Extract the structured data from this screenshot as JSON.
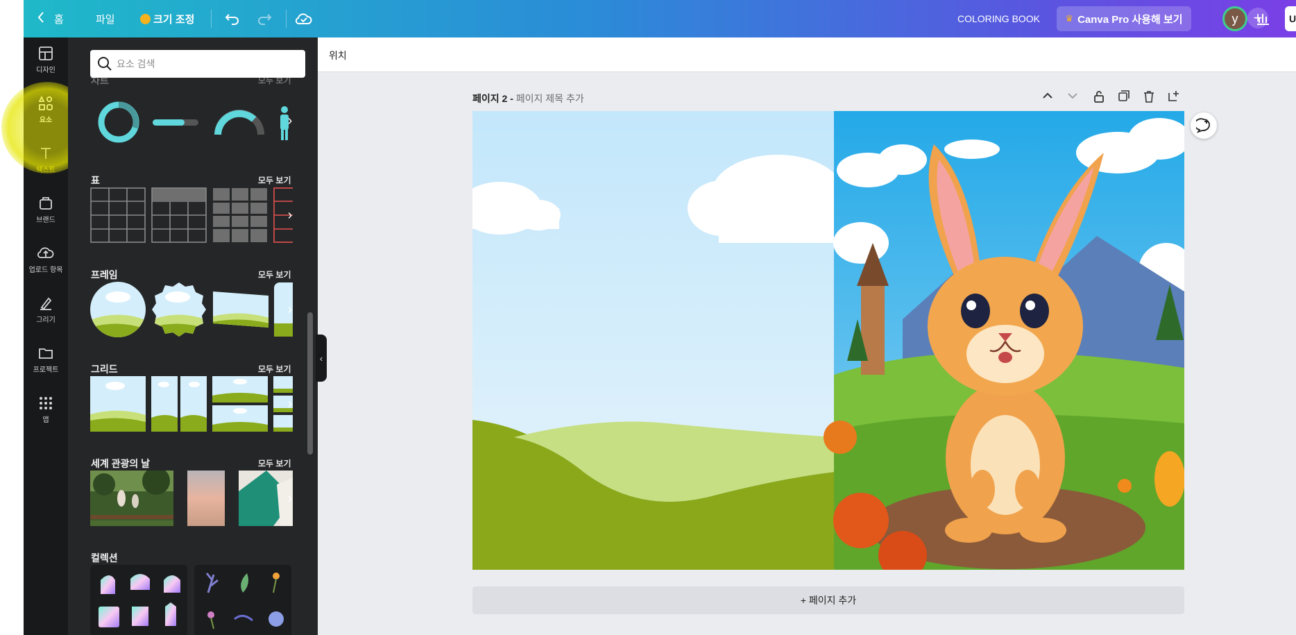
{
  "topbar": {
    "home_label": "홈",
    "file_label": "파일",
    "resize_label": "크기 조정",
    "doc_title": "COLORING BOOK",
    "pro_button": "Canva Pro 사용해 보기",
    "avatar_initial": "y",
    "share_label": "U",
    "gradient_colors": [
      "#1fb9c9",
      "#7a3fe6"
    ]
  },
  "rail": {
    "items": [
      {
        "label": "디자인",
        "icon": "layout-icon"
      },
      {
        "label": "요소",
        "icon": "elements-icon"
      },
      {
        "label": "텍스트",
        "icon": "text-icon"
      },
      {
        "label": "브랜드",
        "icon": "brand-icon"
      },
      {
        "label": "업로드 항목",
        "icon": "upload-icon"
      },
      {
        "label": "그리기",
        "icon": "draw-icon"
      },
      {
        "label": "프로젝트",
        "icon": "folder-icon"
      },
      {
        "label": "앱",
        "icon": "apps-grid-icon"
      }
    ]
  },
  "panel": {
    "search_placeholder": "요소 검색",
    "see_all": "모두 보기",
    "sections": {
      "charts": "차트",
      "tables": "표",
      "frames": "프레임",
      "grids": "그리드",
      "tourism": "세계 관광의 날",
      "collections": "컬렉션"
    }
  },
  "canvas": {
    "position_label": "위치",
    "page_label": "페이지 2 -",
    "page_title_placeholder": "페이지 제목 추가",
    "add_page": "+ 페이지 추가"
  }
}
